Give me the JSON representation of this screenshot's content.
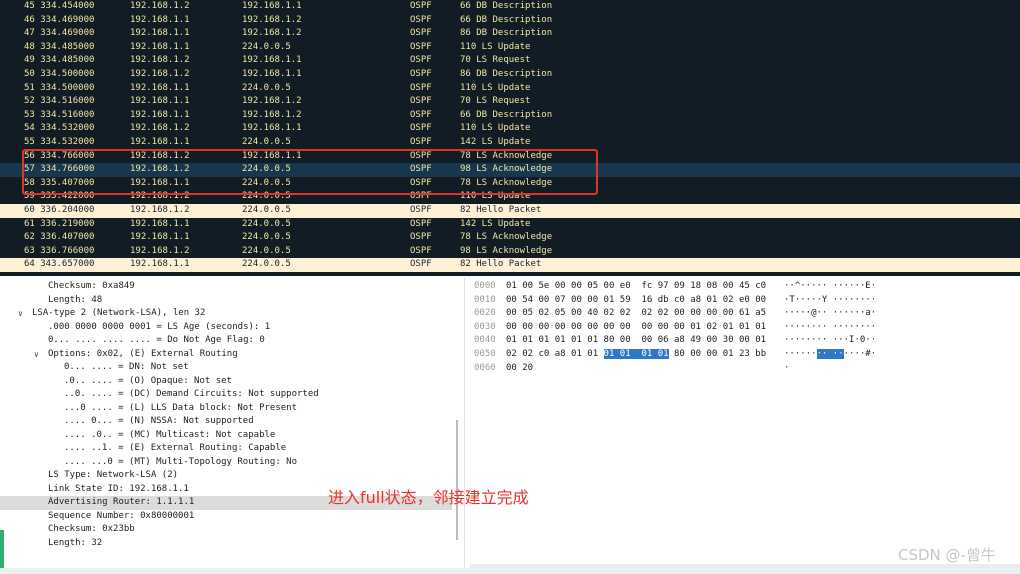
{
  "packets": [
    {
      "no_time": "45 334.454000",
      "src": "192.168.1.2",
      "dst": "192.168.1.1",
      "proto": "OSPF",
      "info": "66 DB Description"
    },
    {
      "no_time": "46 334.469000",
      "src": "192.168.1.1",
      "dst": "192.168.1.2",
      "proto": "OSPF",
      "info": "66 DB Description"
    },
    {
      "no_time": "47 334.469000",
      "src": "192.168.1.1",
      "dst": "192.168.1.2",
      "proto": "OSPF",
      "info": "86 DB Description"
    },
    {
      "no_time": "48 334.485000",
      "src": "192.168.1.1",
      "dst": "224.0.0.5",
      "proto": "OSPF",
      "info": "110 LS Update"
    },
    {
      "no_time": "49 334.485000",
      "src": "192.168.1.2",
      "dst": "192.168.1.1",
      "proto": "OSPF",
      "info": "70 LS Request"
    },
    {
      "no_time": "50 334.500000",
      "src": "192.168.1.2",
      "dst": "192.168.1.1",
      "proto": "OSPF",
      "info": "86 DB Description"
    },
    {
      "no_time": "51 334.500000",
      "src": "192.168.1.1",
      "dst": "224.0.0.5",
      "proto": "OSPF",
      "info": "110 LS Update"
    },
    {
      "no_time": "52 334.516000",
      "src": "192.168.1.1",
      "dst": "192.168.1.2",
      "proto": "OSPF",
      "info": "70 LS Request"
    },
    {
      "no_time": "53 334.516000",
      "src": "192.168.1.1",
      "dst": "192.168.1.2",
      "proto": "OSPF",
      "info": "66 DB Description"
    },
    {
      "no_time": "54 334.532000",
      "src": "192.168.1.2",
      "dst": "192.168.1.1",
      "proto": "OSPF",
      "info": "110 LS Update"
    },
    {
      "no_time": "55 334.532000",
      "src": "192.168.1.1",
      "dst": "224.0.0.5",
      "proto": "OSPF",
      "info": "142 LS Update"
    },
    {
      "no_time": "56 334.766000",
      "src": "192.168.1.2",
      "dst": "192.168.1.1",
      "proto": "OSPF",
      "info": "78 LS Acknowledge"
    },
    {
      "no_time": "57 334.766000",
      "src": "192.168.1.2",
      "dst": "224.0.0.5",
      "proto": "OSPF",
      "info": "98 LS Acknowledge"
    },
    {
      "no_time": "58 335.407000",
      "src": "192.168.1.1",
      "dst": "224.0.0.5",
      "proto": "OSPF",
      "info": "78 LS Acknowledge"
    },
    {
      "no_time": "59 335.422000",
      "src": "192.168.1.2",
      "dst": "224.0.0.5",
      "proto": "OSPF",
      "info": "110 LS Update"
    },
    {
      "no_time": "60 336.204000",
      "src": "192.168.1.2",
      "dst": "224.0.0.5",
      "proto": "OSPF",
      "info": "82 Hello Packet"
    },
    {
      "no_time": "61 336.219000",
      "src": "192.168.1.1",
      "dst": "224.0.0.5",
      "proto": "OSPF",
      "info": "142 LS Update"
    },
    {
      "no_time": "62 336.407000",
      "src": "192.168.1.1",
      "dst": "224.0.0.5",
      "proto": "OSPF",
      "info": "78 LS Acknowledge"
    },
    {
      "no_time": "63 336.766000",
      "src": "192.168.1.2",
      "dst": "224.0.0.5",
      "proto": "OSPF",
      "info": "98 LS Acknowledge"
    },
    {
      "no_time": "64 343.657000",
      "src": "192.168.1.1",
      "dst": "224.0.0.5",
      "proto": "OSPF",
      "info": "82 Hello Packet"
    }
  ],
  "details": [
    {
      "text": "Checksum: 0xa849"
    },
    {
      "text": "Length: 48"
    },
    {
      "text": "LSA-type 2 (Network-LSA), len 32",
      "toggle": "expanded"
    },
    {
      "text": ".000 0000 0000 0001 = LS Age (seconds): 1"
    },
    {
      "text": "0... .... .... .... = Do Not Age Flag: 0"
    },
    {
      "text": "Options: 0x02, (E) External Routing",
      "toggle": "expanded"
    },
    {
      "text": "0... .... = DN: Not set"
    },
    {
      "text": ".0.. .... = (O) Opaque: Not set"
    },
    {
      "text": "..0. .... = (DC) Demand Circuits: Not supported"
    },
    {
      "text": "...0 .... = (L) LLS Data block: Not Present"
    },
    {
      "text": ".... 0... = (N) NSSA: Not supported"
    },
    {
      "text": ".... .0.. = (MC) Multicast: Not capable"
    },
    {
      "text": ".... ..1. = (E) External Routing: Capable"
    },
    {
      "text": ".... ...0 = (MT) Multi-Topology Routing: No"
    },
    {
      "text": "LS Type: Network-LSA (2)"
    },
    {
      "text": "Link State ID: 192.168.1.1"
    },
    {
      "text": "Advertising Router: 1.1.1.1",
      "selected": "true"
    },
    {
      "text": "Sequence Number: 0x80000001"
    },
    {
      "text": "Checksum: 0x23bb"
    },
    {
      "text": "Length: 32"
    }
  ],
  "hex_rows": [
    {
      "offset": "0000",
      "hex_a": "01 00 5e 00 00 05 00 e0  fc 97 09 18 08 00 45 c0",
      "hex_hl": "",
      "hex_b": "",
      "ascii_a": "··^····· ······E·",
      "ascii_hl": "",
      "ascii_b": ""
    },
    {
      "offset": "0010",
      "hex_a": "00 54 00 07 00 00 01 59  16 db c0 a8 01 02 e0 00",
      "hex_hl": "",
      "hex_b": "",
      "ascii_a": "·T·····Y ········",
      "ascii_hl": "",
      "ascii_b": ""
    },
    {
      "offset": "0020",
      "hex_a": "00 05 02 05 00 40 02 02  02 02 00 00 00 00 61 a5",
      "hex_hl": "",
      "hex_b": "",
      "ascii_a": "·····@·· ······a·",
      "ascii_hl": "",
      "ascii_b": ""
    },
    {
      "offset": "0030",
      "hex_a": "00 00 00 00 00 00 00 00  00 00 00 01 02 01 01 01",
      "hex_hl": "",
      "hex_b": "",
      "ascii_a": "········ ········",
      "ascii_hl": "",
      "ascii_b": ""
    },
    {
      "offset": "0040",
      "hex_a": "01 01 01 01 01 01 80 00  00 06 a8 49 00 30 00 01",
      "hex_hl": "",
      "hex_b": "",
      "ascii_a": "········ ···I·0··",
      "ascii_hl": "",
      "ascii_b": ""
    },
    {
      "offset": "0050",
      "hex_a": "02 02 c0 a8 01 01 ",
      "hex_hl": "01 01  01 01",
      "hex_b": " 80 00 00 01 23 bb",
      "ascii_a": "······",
      "ascii_hl": "·· ··",
      "ascii_b": "····#·"
    },
    {
      "offset": "0060",
      "hex_a": "00 20",
      "hex_hl": "",
      "hex_b": "",
      "ascii_a": "·",
      "ascii_hl": "",
      "ascii_b": ""
    }
  ],
  "annotation_text": "进入full状态，邻接建立完成",
  "watermark_text": "CSDN @-曾牛",
  "colors": {
    "list_bg": "#121c24",
    "list_text": "#f0e5a6",
    "hello_row_bg": "#fdf0d5",
    "selected_row_bg": "#17374f",
    "highlight_box": "#e0342a",
    "byte_highlight": "#2f78c8"
  }
}
